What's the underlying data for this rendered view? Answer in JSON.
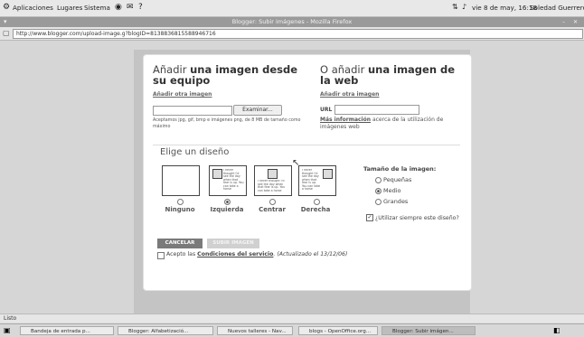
{
  "panel": {
    "applications": "Aplicaciones",
    "places": "Lugares",
    "system": "Sistema",
    "clock": "vie 8 de may, 16:18",
    "user": "Soledad Guerrero"
  },
  "window": {
    "title": "Blogger: Subir imágenes - Mozilla Firefox"
  },
  "browser": {
    "url": "http://www.blogger.com/upload-image.g?blogID=8138836815588946716"
  },
  "upload": {
    "computer_heading_prefix": "Añadir",
    "computer_heading_bold": "una imagen desde su equipo",
    "add_another_left": "Añadir otra imagen",
    "browse_button": "Examinar...",
    "accepted_note": "Aceptamos jpg, gif, bmp e imágenes png, de 8 MB de tamaño como máximo",
    "web_heading_prefix": "O añadir",
    "web_heading_bold": "una imagen de la web",
    "add_another_right": "Añadir otra imagen",
    "url_label": "URL",
    "more_info_link": "Más información",
    "more_info_text": "acerca de la utilización de imágenes web"
  },
  "layout_section": {
    "heading": "Elige un diseño",
    "options": [
      {
        "label": "Ninguno",
        "selected": false
      },
      {
        "label": "Izquierda",
        "selected": true
      },
      {
        "label": "Centrar",
        "selected": false
      },
      {
        "label": "Derecha",
        "selected": false
      }
    ],
    "thumb_text": "I never thought I'd see the day when that fear is up. You can take a horse"
  },
  "size_section": {
    "heading": "Tamaño de la imagen:",
    "options": [
      {
        "label": "Pequeñas",
        "selected": false
      },
      {
        "label": "Medio",
        "selected": true
      },
      {
        "label": "Grandes",
        "selected": false
      }
    ],
    "always_use": "¿Utilizar siempre este diseño?"
  },
  "actions": {
    "cancel": "CANCELAR",
    "upload": "SUBIR IMAGEN",
    "accept_prefix": "Acepto las",
    "terms_link": "Condiciones del servicio",
    "updated": ". (Actualizado el 13/12/06)"
  },
  "status": {
    "text": "Listo"
  },
  "taskbar": {
    "items": [
      {
        "label": "Bandeja de entrada p...",
        "active": false
      },
      {
        "label": "Blogger: Alfabetizació...",
        "active": false
      },
      {
        "label": "Nuevos talleres - Nav...",
        "active": false
      },
      {
        "label": "blogs - OpenOffice.org...",
        "active": false
      },
      {
        "label": "Blogger: Subir imágen...",
        "active": true
      }
    ]
  }
}
